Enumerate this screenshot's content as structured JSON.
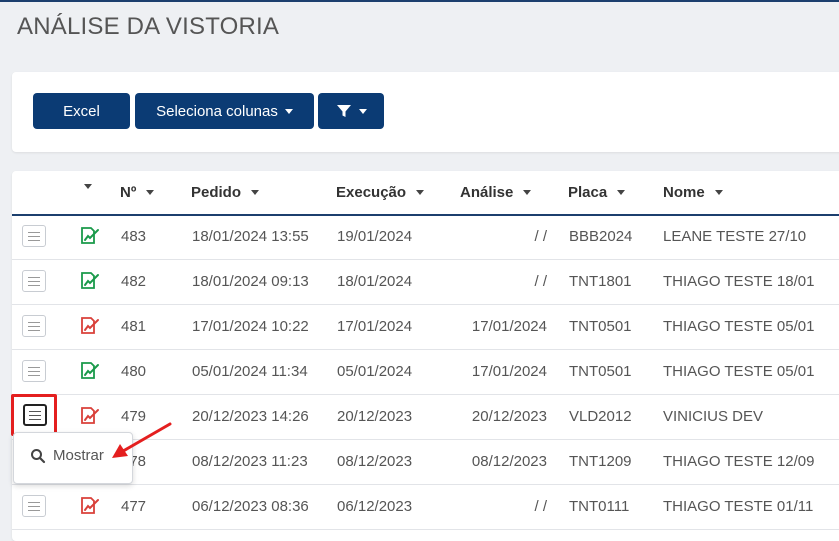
{
  "page": {
    "title": "ANÁLISE DA VISTORIA"
  },
  "toolbar": {
    "excel_label": "Excel",
    "columns_label": "Seleciona colunas",
    "filter_icon": "filter-icon"
  },
  "table": {
    "columns": [
      "Nº",
      "Pedido",
      "Execução",
      "Análise",
      "Placa",
      "Nome"
    ],
    "rows": [
      {
        "num": "483",
        "pedido": "18/01/2024 13:55",
        "execucao": "19/01/2024",
        "analise": "/ /",
        "placa": "BBB2024",
        "nome": "LEANE TESTE 27/10",
        "status": "green"
      },
      {
        "num": "482",
        "pedido": "18/01/2024 09:13",
        "execucao": "18/01/2024",
        "analise": "/ /",
        "placa": "TNT1801",
        "nome": "THIAGO TESTE 18/01",
        "status": "green"
      },
      {
        "num": "481",
        "pedido": "17/01/2024 10:22",
        "execucao": "17/01/2024",
        "analise": "17/01/2024",
        "placa": "TNT0501",
        "nome": "THIAGO TESTE 05/01",
        "status": "red"
      },
      {
        "num": "480",
        "pedido": "05/01/2024 11:34",
        "execucao": "05/01/2024",
        "analise": "17/01/2024",
        "placa": "TNT0501",
        "nome": "THIAGO TESTE 05/01",
        "status": "green"
      },
      {
        "num": "479",
        "pedido": "20/12/2023 14:26",
        "execucao": "20/12/2023",
        "analise": "20/12/2023",
        "placa": "VLD2012",
        "nome": "VINICIUS DEV",
        "status": "red"
      },
      {
        "num": "478",
        "pedido": "08/12/2023 11:23",
        "execucao": "08/12/2023",
        "analise": "08/12/2023",
        "placa": "TNT1209",
        "nome": "THIAGO TESTE 12/09",
        "status": "red"
      },
      {
        "num": "477",
        "pedido": "06/12/2023 08:36",
        "execucao": "06/12/2023",
        "analise": "/ /",
        "placa": "TNT0111",
        "nome": "THIAGO TESTE 01/11",
        "status": "red"
      }
    ]
  },
  "dropdown": {
    "show_label": "Mostrar",
    "icon": "search-icon"
  },
  "colors": {
    "primary": "#0b3b74",
    "green": "#1a9a4a",
    "red": "#d9403a",
    "highlight": "#e41f1f"
  }
}
